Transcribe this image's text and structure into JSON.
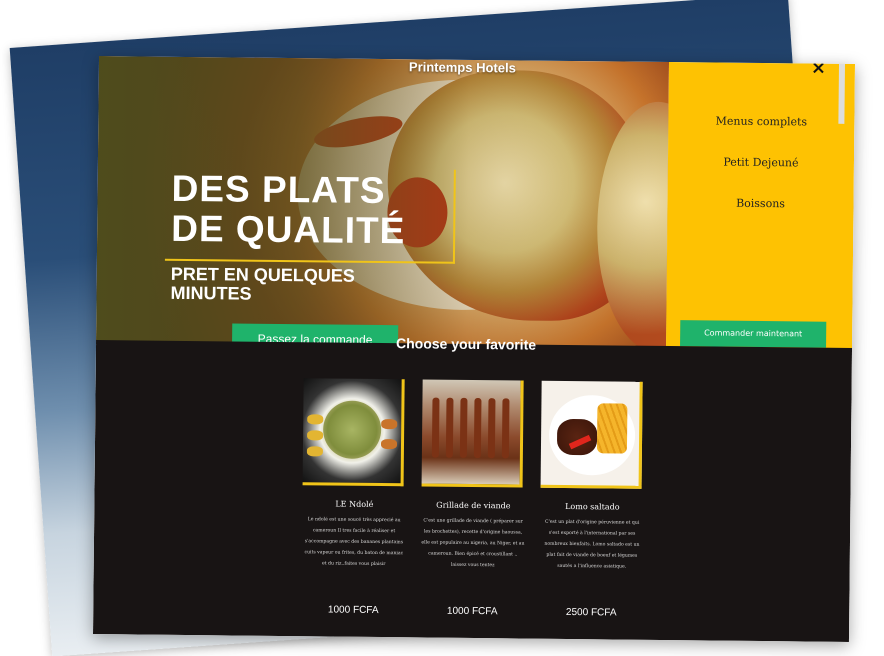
{
  "header": {
    "brand": "Printemps Hotels",
    "close_symbol": "×"
  },
  "hero": {
    "headline_line1": "DES PLATS",
    "headline_line2": "DE QUALITÉ",
    "subhead_line1": "PRET EN QUELQUES",
    "subhead_line2": "MINUTES",
    "cta_label": "Passez la commande"
  },
  "sidebar": {
    "items": [
      {
        "label": "Menus complets"
      },
      {
        "label": "Petit Dejeuné"
      },
      {
        "label": "Boissons"
      }
    ],
    "cta_label": "Commander maintenant"
  },
  "favorites": {
    "title": "Choose your favorite",
    "dishes": [
      {
        "name": "LE Ndolé",
        "description": "Le ndolé est une soucé très apprecié au cameroun Il tres facile à réaliser et s'accompagne avec des bananes plantains cuits vapeur ou frites, du baton de maniac et du riz..faites vous plaisir",
        "price": "1000 FCFA"
      },
      {
        "name": "Grillade de viande",
        "description": "C'est une grillade de viande ( préparer sur les brochettes), recette d'origine haoussa, elle est populaire au nigeria, au Niger, et au cameroun. Bien épicé et croustillant .. laissez vous tentez",
        "price": "1000 FCFA"
      },
      {
        "name": "Lomo saltado",
        "description": "C'est un plat d'origine péruvienne et qui s'est exporté à l'international par ses nombreux bienfaits. Lomo saltado est un plat fait de viande de boeuf et légumes sautés a l'influence asiatique.",
        "price": "2500 FCFA"
      }
    ]
  },
  "colors": {
    "accent_yellow": "#fec202",
    "cta_green": "#1fb36b",
    "dark_bg": "#181414"
  }
}
